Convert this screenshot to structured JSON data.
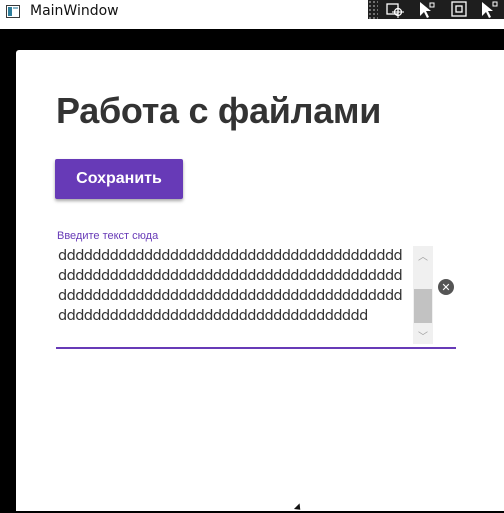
{
  "window": {
    "title": "MainWindow"
  },
  "debug_toolbar": {
    "items": [
      "dots-handle-icon",
      "select-element-icon",
      "display-adorners-icon",
      "track-focus-icon",
      "pointer-icon"
    ]
  },
  "main": {
    "heading": "Работа с файлами",
    "save_label": "Сохранить",
    "textbox": {
      "hint": "Введите текст сюда",
      "value": "dddddddddddddddddddddddddddddddddddddddddddddddddddddddddddddddddddddddddddddddddddddddddddddddddddddddddddddddddddddddddddddddddddddddddddddddddddddddddddd"
    }
  },
  "colors": {
    "accent": "#673ab7",
    "heading": "#333333",
    "toolbar": "#1e1e1e"
  }
}
